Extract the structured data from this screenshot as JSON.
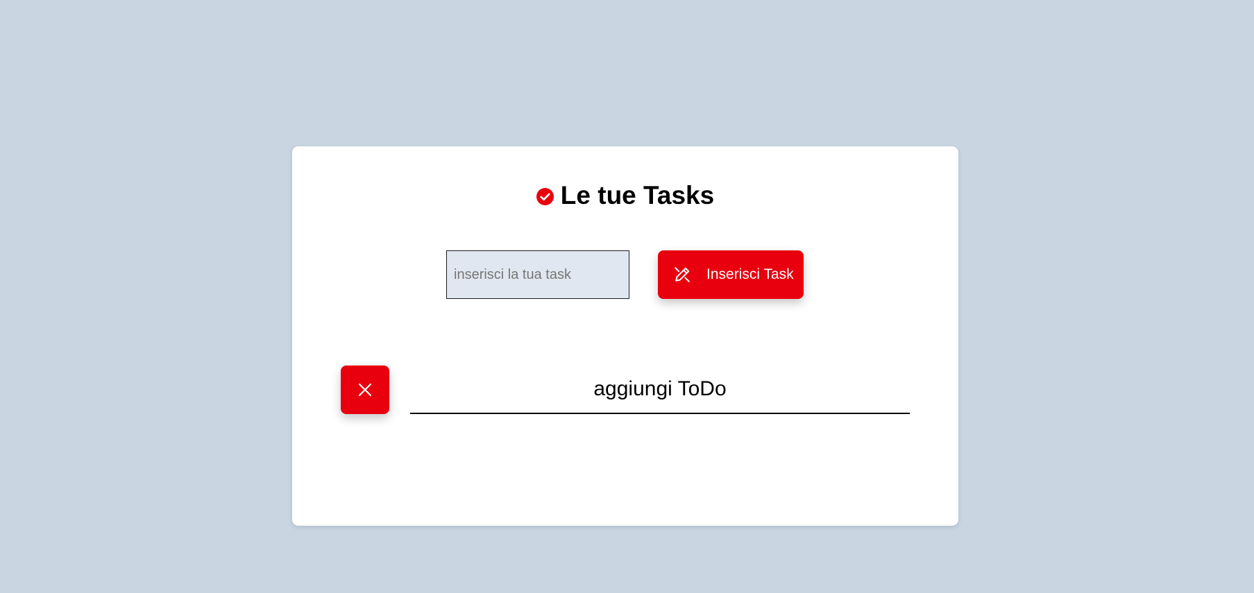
{
  "colors": {
    "background": "#c9d5e1",
    "card": "#ffffff",
    "accent": "#e8000f",
    "input_bg": "#e1e7f0"
  },
  "header": {
    "icon": "check-circle-icon",
    "title": "Le tue Tasks"
  },
  "form": {
    "input_placeholder": "inserisci la tua task",
    "input_value": "",
    "add_button_icon": "pencil-icon",
    "add_button_label": "Inserisci Task"
  },
  "todos": [
    {
      "text": "aggiungi ToDo",
      "delete_icon": "close-icon"
    }
  ]
}
